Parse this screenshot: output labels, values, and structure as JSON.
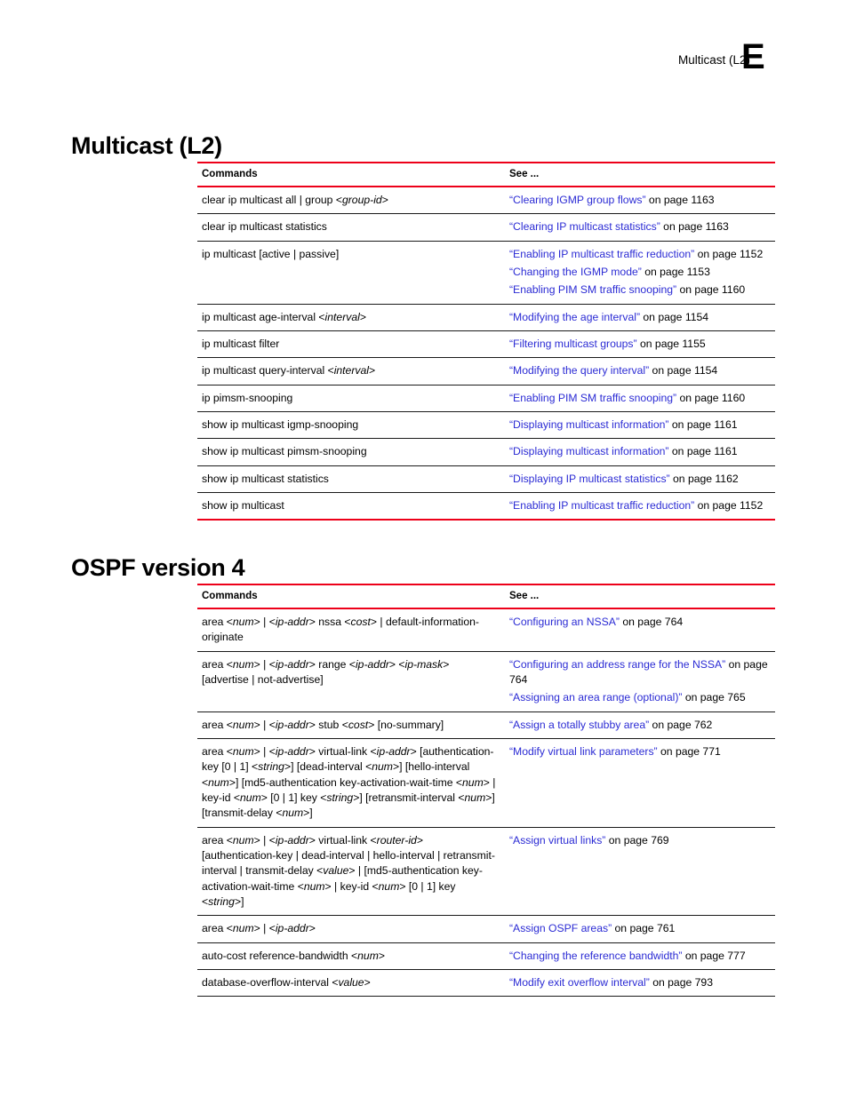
{
  "header": {
    "running_title": "Multicast (L2)",
    "appendix_letter": "E"
  },
  "colors": {
    "rule_red": "#ED0019",
    "link_blue": "#2B2BD4",
    "text_black": "#000000"
  },
  "sections": [
    {
      "id": "multicast",
      "heading": "Multicast (L2)",
      "table": {
        "columns": [
          "Commands",
          "See ..."
        ],
        "bottom_rule": true,
        "rows": [
          {
            "command": "clear ip multicast all | group <group-id>",
            "see": [
              {
                "link": "“Clearing IGMP group flows”",
                "suffix": " on page 1163"
              }
            ]
          },
          {
            "command": "clear ip multicast statistics",
            "see": [
              {
                "link": "“Clearing IP multicast statistics”",
                "suffix": " on page 1163"
              }
            ]
          },
          {
            "command": "ip multicast [active | passive]",
            "see": [
              {
                "link": "“Enabling IP multicast traffic reduction”",
                "suffix": " on page 1152"
              },
              {
                "link": "“Changing the IGMP mode”",
                "suffix": " on page 1153"
              },
              {
                "link": "“Enabling PIM SM traffic snooping”",
                "suffix": " on page 1160"
              }
            ]
          },
          {
            "command": "ip multicast age-interval <interval>",
            "see": [
              {
                "link": "“Modifying the age interval”",
                "suffix": " on page 1154"
              }
            ]
          },
          {
            "command": "ip multicast filter",
            "see": [
              {
                "link": "“Filtering multicast groups”",
                "suffix": " on page 1155"
              }
            ]
          },
          {
            "command": "ip multicast query-interval <interval>",
            "see": [
              {
                "link": "“Modifying the query interval”",
                "suffix": " on page 1154"
              }
            ]
          },
          {
            "command": "ip pimsm-snooping",
            "see": [
              {
                "link": "“Enabling PIM SM traffic snooping”",
                "suffix": " on page 1160"
              }
            ]
          },
          {
            "command": "show ip multicast igmp-snooping",
            "see": [
              {
                "link": "“Displaying multicast information”",
                "suffix": " on page 1161"
              }
            ]
          },
          {
            "command": "show ip multicast pimsm-snooping",
            "see": [
              {
                "link": "“Displaying multicast information”",
                "suffix": " on page 1161"
              }
            ]
          },
          {
            "command": "show ip multicast statistics",
            "see": [
              {
                "link": "“Displaying IP multicast statistics”",
                "suffix": " on page 1162"
              }
            ]
          },
          {
            "command": "show ip multicast",
            "see": [
              {
                "link": "“Enabling IP multicast traffic reduction”",
                "suffix": " on page 1152"
              }
            ]
          }
        ]
      }
    },
    {
      "id": "ospf",
      "heading": "OSPF version 4",
      "table": {
        "columns": [
          "Commands",
          "See ..."
        ],
        "bottom_rule": false,
        "rows": [
          {
            "command": "area <num> | <ip-addr> nssa <cost> | default-information-originate",
            "see": [
              {
                "link": "“Configuring an NSSA”",
                "suffix": " on page 764"
              }
            ]
          },
          {
            "command": "area <num> | <ip-addr> range <ip-addr> <ip-mask> [advertise | not-advertise]",
            "see": [
              {
                "link": "“Configuring an address range for the NSSA”",
                "suffix": " on page 764"
              },
              {
                "link": "“Assigning an area range (optional)”",
                "suffix": " on page 765"
              }
            ]
          },
          {
            "command": "area <num> | <ip-addr> stub <cost> [no-summary]",
            "see": [
              {
                "link": "“Assign a totally stubby area”",
                "suffix": " on page 762"
              }
            ]
          },
          {
            "command": "area <num> | <ip-addr> virtual-link <ip-addr> [authentication-key [0 | 1] <string>] [dead-interval <num>] [hello-interval <num>] [md5-authentication key-activation-wait-time <num> | key-id <num> [0 | 1] key <string>] [retransmit-interval <num>] [transmit-delay <num>]",
            "see": [
              {
                "link": "“Modify virtual link parameters”",
                "suffix": " on page 771"
              }
            ]
          },
          {
            "command": "area <num> | <ip-addr> virtual-link <router-id> [authentication-key | dead-interval | hello-interval | retransmit-interval | transmit-delay <value> | [md5-authentication key-activation-wait-time <num> | key-id <num> [0 | 1] key <string>]",
            "see": [
              {
                "link": "“Assign virtual links”",
                "suffix": " on page 769"
              }
            ]
          },
          {
            "command": "area <num> | <ip-addr>",
            "see": [
              {
                "link": "“Assign OSPF areas”",
                "suffix": " on page 761"
              }
            ]
          },
          {
            "command": "auto-cost reference-bandwidth <num>",
            "see": [
              {
                "link": "“Changing the reference bandwidth”",
                "suffix": " on page 777"
              }
            ]
          },
          {
            "command": "database-overflow-interval <value>",
            "see": [
              {
                "link": "“Modify exit overflow interval”",
                "suffix": " on page 793"
              }
            ]
          }
        ]
      }
    }
  ]
}
